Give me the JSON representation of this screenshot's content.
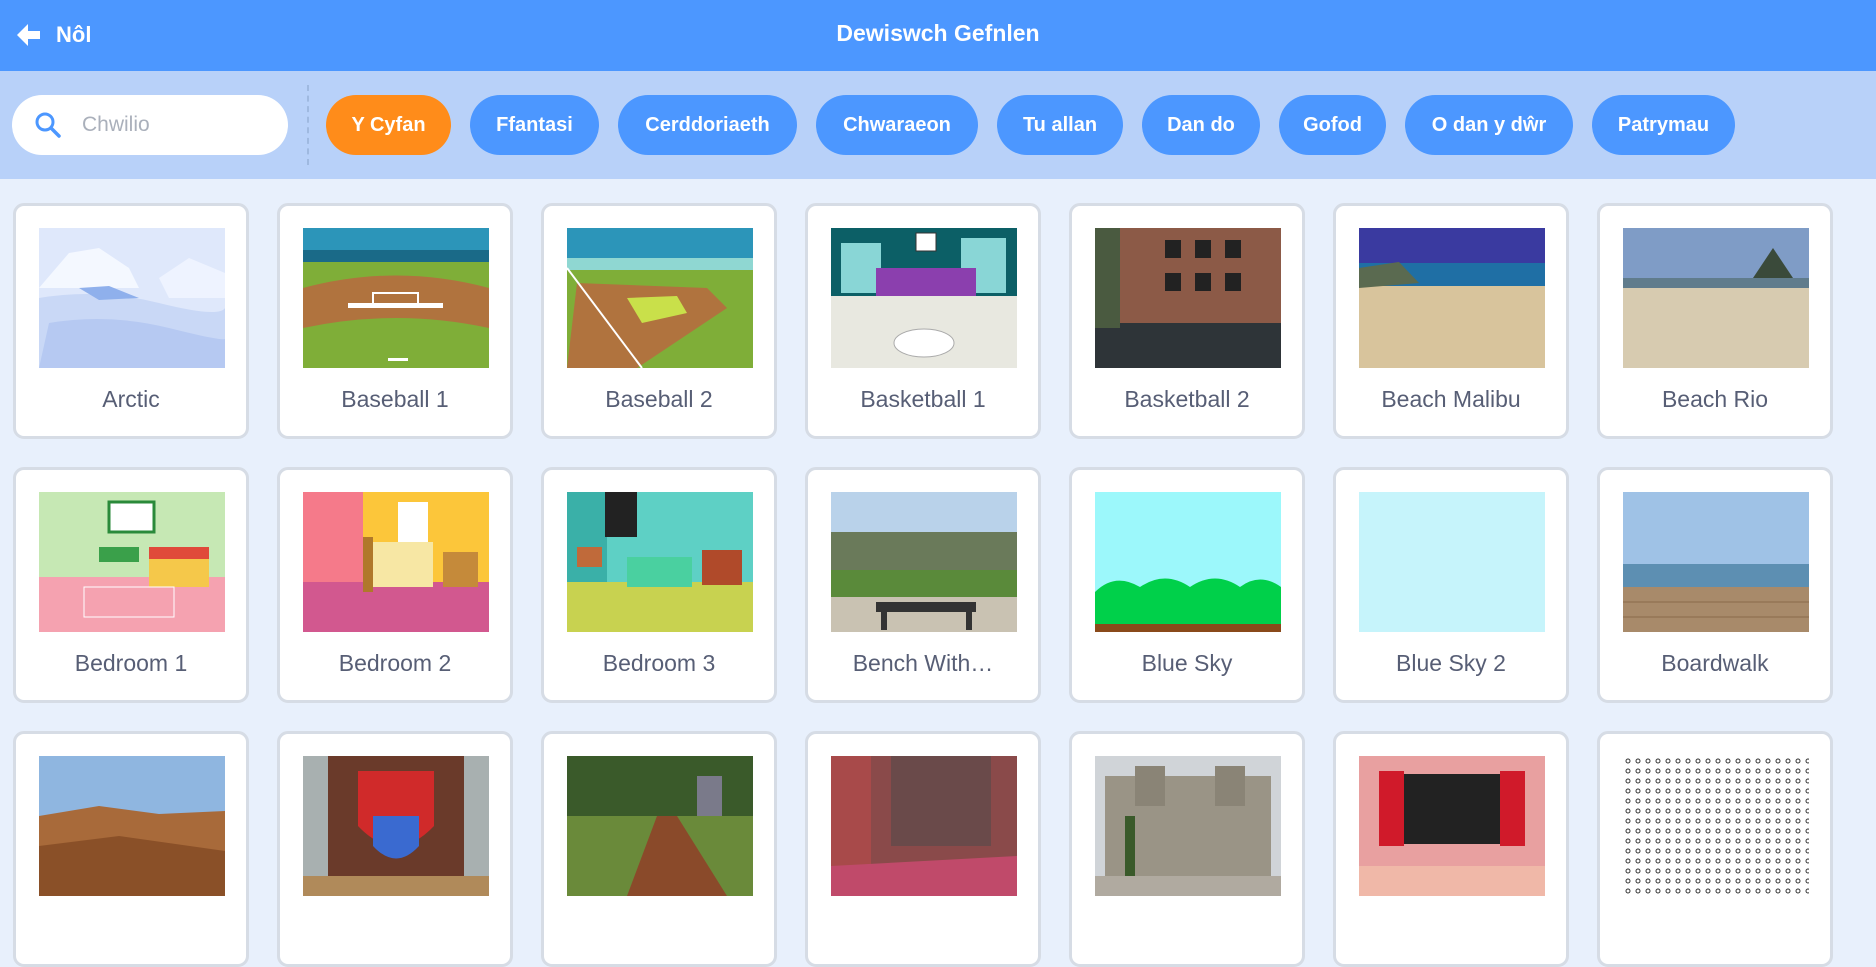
{
  "header": {
    "back_label": "Nôl",
    "title": "Dewiswch Gefnlen"
  },
  "search": {
    "placeholder": "Chwilio"
  },
  "tags": [
    {
      "label": "Y Cyfan",
      "active": true
    },
    {
      "label": "Ffantasi",
      "active": false
    },
    {
      "label": "Cerddoriaeth",
      "active": false
    },
    {
      "label": "Chwaraeon",
      "active": false
    },
    {
      "label": "Tu allan",
      "active": false
    },
    {
      "label": "Dan do",
      "active": false
    },
    {
      "label": "Gofod",
      "active": false
    },
    {
      "label": "O dan y dŵr",
      "active": false
    },
    {
      "label": "Patrymau",
      "active": false
    }
  ],
  "backdrops": [
    {
      "label": "Arctic",
      "icon": "arctic"
    },
    {
      "label": "Baseball 1",
      "icon": "baseball-1"
    },
    {
      "label": "Baseball 2",
      "icon": "baseball-2"
    },
    {
      "label": "Basketball 1",
      "icon": "basketball-1"
    },
    {
      "label": "Basketball 2",
      "icon": "basketball-2"
    },
    {
      "label": "Beach Malibu",
      "icon": "beach-malibu"
    },
    {
      "label": "Beach Rio",
      "icon": "beach-rio"
    },
    {
      "label": "Bedroom 1",
      "icon": "bedroom-1"
    },
    {
      "label": "Bedroom 2",
      "icon": "bedroom-2"
    },
    {
      "label": "Bedroom 3",
      "icon": "bedroom-3"
    },
    {
      "label": "Bench With…",
      "icon": "bench-with-view"
    },
    {
      "label": "Blue Sky",
      "icon": "blue-sky"
    },
    {
      "label": "Blue Sky 2",
      "icon": "blue-sky-2"
    },
    {
      "label": "Boardwalk",
      "icon": "boardwalk"
    },
    {
      "label": "",
      "icon": "canyon"
    },
    {
      "label": "",
      "icon": "castle-crest"
    },
    {
      "label": "",
      "icon": "forest-path"
    },
    {
      "label": "",
      "icon": "hall"
    },
    {
      "label": "",
      "icon": "palace"
    },
    {
      "label": "",
      "icon": "theater"
    },
    {
      "label": "",
      "icon": "dots-pattern"
    }
  ],
  "colors": {
    "header": "#4c97ff",
    "filterbar": "#b8d1f9",
    "active_tag": "#ff8c1a",
    "tag": "#4c97ff"
  }
}
